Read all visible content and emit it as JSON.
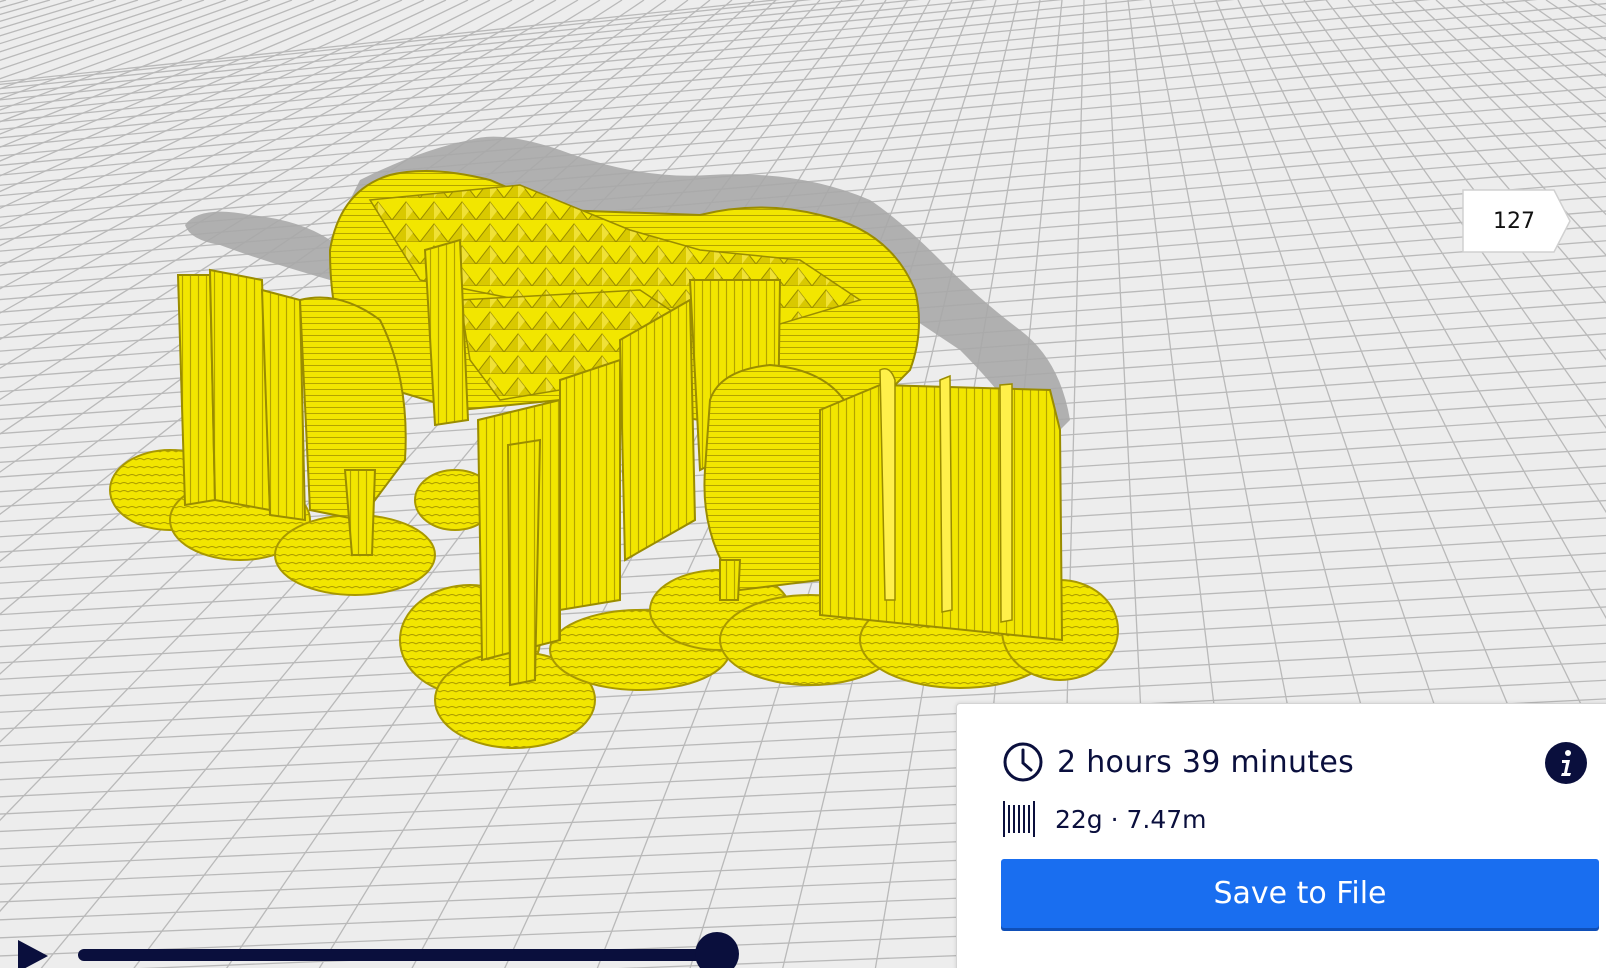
{
  "viewport": {
    "colors": {
      "background": "#ededed",
      "grid": "#b9b9b9",
      "model": "#f2e600",
      "model_edge": "#a89800",
      "shadow": "#a9a9a9"
    }
  },
  "layer_slider": {
    "current_layer": "127"
  },
  "print_info": {
    "time_icon": "clock-icon",
    "time_text": "2 hours 39 minutes",
    "info_icon": "info-icon",
    "material_icon": "filament-spool-icon",
    "material_text": "22g · 7.47m",
    "save_label": "Save to File",
    "accent": "#196ef0"
  },
  "simulation": {
    "play_icon": "play-icon",
    "progress": 1.0
  }
}
